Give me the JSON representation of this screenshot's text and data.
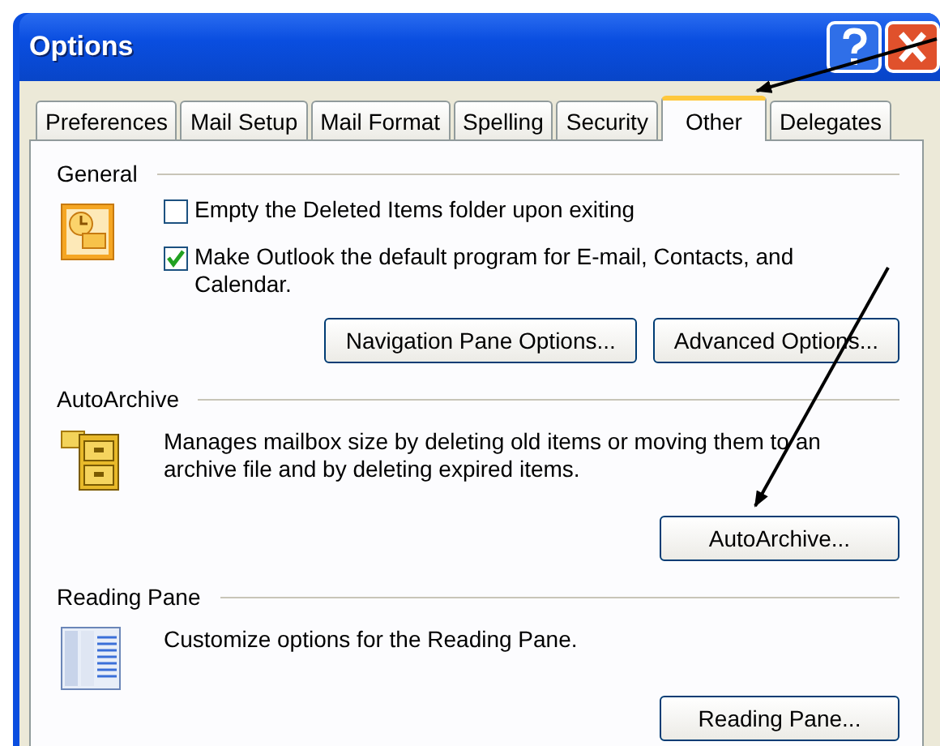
{
  "window": {
    "title": "Options"
  },
  "tabs": [
    {
      "label": "Preferences",
      "selected": false
    },
    {
      "label": "Mail Setup",
      "selected": false
    },
    {
      "label": "Mail Format",
      "selected": false
    },
    {
      "label": "Spelling",
      "selected": false
    },
    {
      "label": "Security",
      "selected": false
    },
    {
      "label": "Other",
      "selected": true
    },
    {
      "label": "Delegates",
      "selected": false
    }
  ],
  "sections": [
    {
      "heading": "General",
      "kind": "options",
      "checkboxes": [
        {
          "label": "Empty the Deleted Items folder upon exiting",
          "checked": false
        },
        {
          "label": "Make Outlook the default program for E-mail, Contacts, and Calendar.",
          "checked": true
        }
      ],
      "buttons": [
        "Navigation Pane Options...",
        "Advanced Options..."
      ]
    },
    {
      "heading": "AutoArchive",
      "kind": "description",
      "description": "Manages mailbox size by deleting old items or moving them to an archive file and by deleting expired items.",
      "buttons": [
        "AutoArchive..."
      ]
    },
    {
      "heading": "Reading Pane",
      "kind": "description",
      "description": "Customize options for the Reading Pane.",
      "buttons": [
        "Reading Pane..."
      ]
    }
  ]
}
